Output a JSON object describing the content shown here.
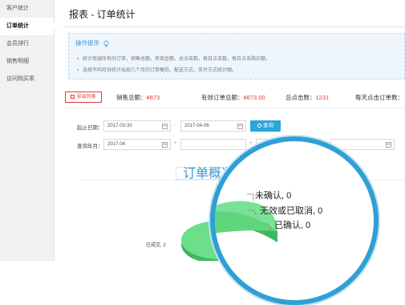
{
  "sidebar": {
    "items": [
      {
        "label": "客户统计",
        "active": false
      },
      {
        "label": "订单统计",
        "active": true
      },
      {
        "label": "会员排行",
        "active": false
      },
      {
        "label": "销售明细",
        "active": false
      },
      {
        "label": "访问购买率",
        "active": false
      }
    ]
  },
  "page": {
    "title": "报表 - 订单统计"
  },
  "tips": {
    "title": "操作提示",
    "lines": [
      "统计商城所有的订单，销售总额，有效金额，总点击数，每日点击数，每日点击购买额。",
      "选择不同月份统计出现几个月的订单概括、配送方式、支付方式统计图。"
    ]
  },
  "stats": {
    "export_label": "导出列表",
    "sales_label": "销售总额：",
    "sales_value": "¥873",
    "valid_label": "有效订单总额：",
    "valid_value": "¥873.00",
    "clicks_label": "总点击数：",
    "clicks_value": "1231",
    "daily_label": "每天点击订单数："
  },
  "filters": {
    "date_label": "起止日期：",
    "start_date": "2017-03-30",
    "end_date": "2017-04-06",
    "search_label": "查询",
    "month_label": "查询年月：",
    "month_value": "2017-04"
  },
  "tabs": {
    "overview_label": "订单概况"
  },
  "pie": {
    "small_label": "已成交, 2"
  },
  "magnifier": {
    "labels": [
      "未确认, 0",
      "无效或已取消, 0",
      "已确认, 0"
    ]
  },
  "colors": {
    "accent_blue": "#2aa6d9",
    "accent_red": "#e4393c",
    "pie_green": "#5fd67d"
  }
}
